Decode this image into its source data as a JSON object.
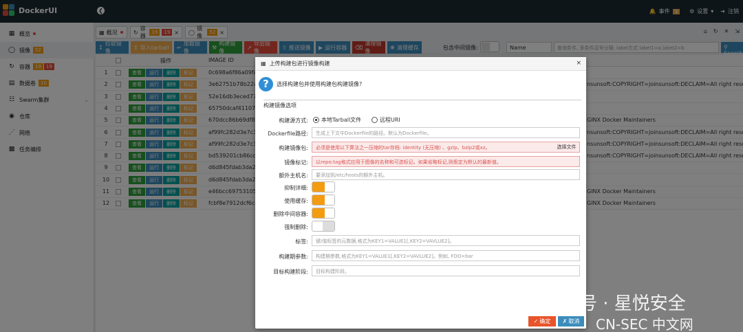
{
  "app": {
    "title": "DockerUI"
  },
  "topbar": {
    "events_label": "事件",
    "events_count": "3",
    "settings_label": "设置",
    "logout_label": "注销"
  },
  "sidebar": {
    "items": [
      {
        "label": "概览",
        "icon": "dashboard-icon"
      },
      {
        "label": "镜像",
        "badge": "52",
        "icon": "headphone-icon"
      },
      {
        "label": "容器",
        "badge1": "19",
        "badge2": "19",
        "icon": "refresh-icon"
      },
      {
        "label": "数据卷",
        "badge": "10",
        "icon": "database-icon"
      },
      {
        "label": "Swarm集群",
        "icon": "sitemap-icon"
      },
      {
        "label": "仓库",
        "icon": "globe-icon"
      },
      {
        "label": "网络",
        "icon": "share-icon"
      },
      {
        "label": "任务编排",
        "icon": "tasks-icon"
      }
    ]
  },
  "tabs": [
    {
      "label": "概况"
    },
    {
      "label": "容器",
      "badge1": "19",
      "badge2": "19"
    },
    {
      "label": "镜像",
      "badge": "52"
    }
  ],
  "toolbar": {
    "buttons": [
      "拉取镜像",
      "导入tarball",
      "加载镜像",
      "构建镜像",
      "导出镜像",
      "推送镜像",
      "运行容器",
      "清理镜像",
      "清理缓存"
    ],
    "include_intermediate_label": "包含中间镜像:",
    "select_value": "Name",
    "search_placeholder": "查询条件, 多条件逗号分隔: label方式 label1=a,label2=b",
    "search_button": "Search"
  },
  "table": {
    "col_action": "操作",
    "col_id": "IMAGE ID",
    "actions": [
      "查看",
      "运行",
      "删除",
      "标记"
    ],
    "rows": [
      {
        "num": "1",
        "id": "0c698a6f86a09fa3",
        "label": ""
      },
      {
        "num": "2",
        "id": "3e62751b78b22a4",
        "label": "nsunsoft:COPYRIGHT=joinsunsoft:DECLAIM=All right reserve"
      },
      {
        "num": "3",
        "id": "52e16db3eced77f",
        "label": ""
      },
      {
        "num": "4",
        "id": "65750dcaf411074",
        "label": ""
      },
      {
        "num": "5",
        "id": "670dcc86b69df89",
        "label": "GINX Docker Maintainers"
      },
      {
        "num": "6",
        "id": "af99fc282d3e7c34",
        "label": "nsunsoft:COPYRIGHT=joinsunsoft:DECLAIM=All right reserve"
      },
      {
        "num": "7",
        "id": "af99fc282d3e7c34",
        "label": "nsunsoft:COPYRIGHT=joinsunsoft:DECLAIM=All right reserve"
      },
      {
        "num": "8",
        "id": "bd539201cb86cd9",
        "label": "nsunsoft:COPYRIGHT=joinsunsoft:DECLAIM=All right reserve"
      },
      {
        "num": "9",
        "id": "d6d845fdab3da27",
        "label": ""
      },
      {
        "num": "10",
        "id": "d6d845fdab3da27",
        "label": ""
      },
      {
        "num": "11",
        "id": "e46bcc69753105c",
        "label": "GINX Docker Maintainers"
      },
      {
        "num": "12",
        "id": "fcbf8e7912dcf6c6",
        "label": "GINX Docker Maintainers"
      }
    ]
  },
  "modal": {
    "title": "上传构建包进行镜像构建",
    "question": "选择构建包并使用构建包构建镜像?",
    "section": "构建镜像选项",
    "source_label": "构建源方式:",
    "source_tarball": "本地Tarball文件",
    "source_uri": "远程URI",
    "dockerfile_label": "Dockerfile路径:",
    "dockerfile_placeholder": "生成上下文中Dockerfile的路径。默认为Dockerfile。",
    "package_label": "构建镜像包:",
    "package_placeholder": "必须是使用以下算法之一压缩的tar存档: identity (无压缩) 、gzip、bzip2或xz。",
    "choose_file": "选择文件",
    "tag_label": "镜像标记:",
    "tag_placeholder": "以repo:tag格式应用于图像的名称和可选标记。如果省略标记,则假定为默认的最新值。",
    "hosts_label": "额外主机名:",
    "hosts_placeholder": "要添加到/etc/hosts的额外主机。",
    "suppress_label": "抑制详细:",
    "cache_label": "使用缓存:",
    "rm_label": "删除中间容器:",
    "forcerm_label": "强制删除:",
    "labels_label": "标签:",
    "labels_placeholder": "键/值标签的元数据,格式为KEY1=VALUE1[,KEY2=VAVLUE2]。",
    "buildargs_label": "构建期参数:",
    "buildargs_placeholder": "构建期参数,格式为KEY1=VALUE1[,KEY2=VAVLUE2]。例如, FOO=bar",
    "target_label": "目标构建阶段:",
    "target_placeholder": "目标构建阶段。",
    "ok": "确定",
    "cancel": "取消"
  },
  "watermark": {
    "line1": "公众号 · 星悦安全",
    "line2": "CN-SEC 中文网"
  },
  "colors": {
    "topbar": "#1d2a33",
    "view": "#2e9e3a",
    "run": "#3c8dbc",
    "delete": "#00a0a0",
    "tag": "#f0ad4e",
    "ok": "#e8542b",
    "cancel": "#3c8dbc"
  }
}
